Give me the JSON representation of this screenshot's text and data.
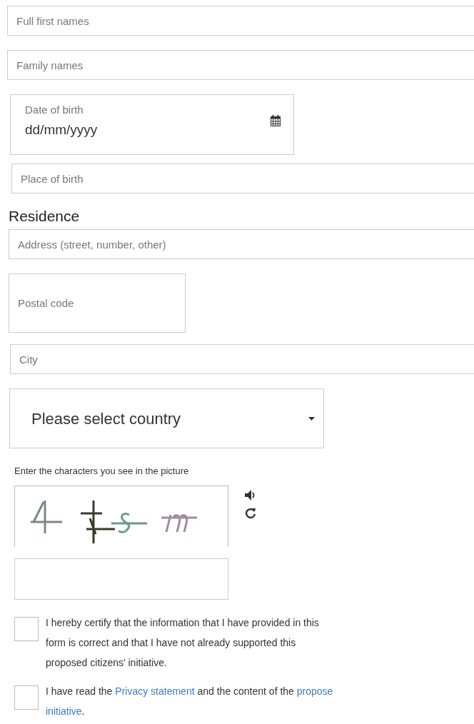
{
  "fields": [
    {
      "kind": "text",
      "placeholder": "Full first names"
    },
    {
      "kind": "text",
      "placeholder": "Family names"
    },
    {
      "kind": "date",
      "label": "Date of birth",
      "placeholder": "dd/mm/yyyy"
    },
    {
      "kind": "text",
      "placeholder": "Place of birth"
    },
    {
      "kind": "heading",
      "label": "Residence"
    },
    {
      "kind": "text",
      "placeholder": "Address (street, number, other)"
    },
    {
      "kind": "tall",
      "placeholder": "Postal code"
    },
    {
      "kind": "text",
      "placeholder": "City"
    },
    {
      "kind": "select",
      "value": "Please select country"
    }
  ],
  "captcha": {
    "label": "Enter the characters you see in the picture"
  },
  "consents": [
    {
      "checked": false,
      "lines": [
        [
          {
            "text": "I hereby certify that the information that I have provided in this"
          }
        ],
        [
          {
            "text": "form is correct and that I have not already supported this"
          }
        ],
        [
          {
            "text": "proposed citizens' initiative."
          }
        ]
      ]
    },
    {
      "checked": false,
      "lines": [
        [
          {
            "text": "I have read the "
          },
          {
            "text": "Privacy statement",
            "link": true
          },
          {
            "text": " and the content of the "
          },
          {
            "text": "propose",
            "link": true
          }
        ],
        [
          {
            "text": "initiative",
            "link": true
          },
          {
            "text": "."
          }
        ]
      ]
    }
  ]
}
